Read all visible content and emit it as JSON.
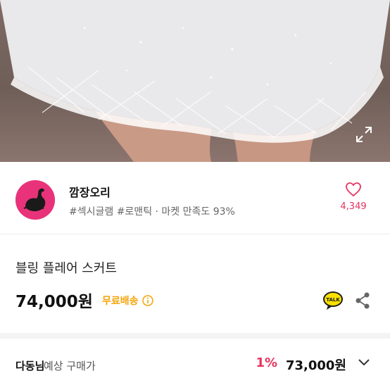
{
  "shop": {
    "name": "깜장오리",
    "tags": "#섹시글램 #로맨틱 · 마켓 만족도 93%",
    "like_count": "4,349"
  },
  "product": {
    "title": "블링 플레어 스커트",
    "price": "74,000원",
    "shipping": "무료배송",
    "talk_badge": "TALK"
  },
  "buyer": {
    "name": "다동님",
    "label": "예상 구매가",
    "discount": "1%",
    "price": "73,000원"
  },
  "colors": {
    "accent": "#e8335f",
    "shipping": "#f5a40a",
    "avatar_bg": "#e8337a"
  },
  "icons": {
    "expand": "expand-icon",
    "like": "heart-icon",
    "info": "info-icon",
    "talk": "kakao-talk-icon",
    "share": "share-icon",
    "chevron": "chevron-down-icon"
  }
}
